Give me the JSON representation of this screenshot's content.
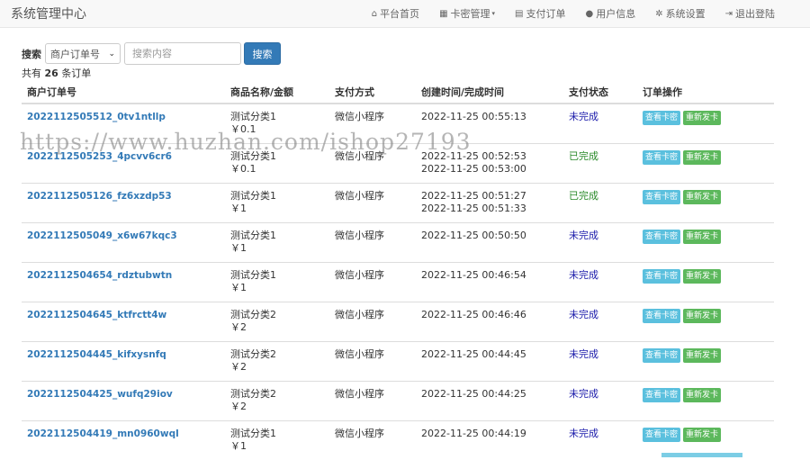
{
  "app": {
    "title": "系统管理中心"
  },
  "nav": [
    {
      "icon": "home-icon",
      "glyph": "⌂",
      "label": "平台首页"
    },
    {
      "icon": "grid-icon",
      "glyph": "▦",
      "label": "卡密管理",
      "dropdown": true
    },
    {
      "icon": "list-icon",
      "glyph": "▤",
      "label": "支付订单"
    },
    {
      "icon": "user-icon",
      "glyph": "●",
      "label": "用户信息"
    },
    {
      "icon": "gear-icon",
      "glyph": "✲",
      "label": "系统设置"
    },
    {
      "icon": "logout-icon",
      "glyph": "⇥",
      "label": "退出登陆"
    }
  ],
  "search": {
    "label": "搜索",
    "select_value": "商户订单号",
    "placeholder": "搜索内容",
    "button": "搜索"
  },
  "summary": {
    "prefix": "共有",
    "count": "26",
    "suffix": "条订单"
  },
  "table": {
    "headers": [
      "商户订单号",
      "商品名称/金额",
      "支付方式",
      "创建时间/完成时间",
      "支付状态",
      "订单操作"
    ],
    "rows": [
      {
        "id": "2022112505512_0tv1ntllp",
        "name": "测试分类1",
        "amount": "￥0.1",
        "pay": "微信小程序",
        "created": "2022-11-25 00:55:13",
        "finished": "",
        "status": "未完成",
        "done": false
      },
      {
        "id": "2022112505253_4pcvv6cr6",
        "name": "测试分类1",
        "amount": "￥0.1",
        "pay": "微信小程序",
        "created": "2022-11-25 00:52:53",
        "finished": "2022-11-25 00:53:00",
        "status": "已完成",
        "done": true
      },
      {
        "id": "2022112505126_fz6xzdp53",
        "name": "测试分类1",
        "amount": "￥1",
        "pay": "微信小程序",
        "created": "2022-11-25 00:51:27",
        "finished": "2022-11-25 00:51:33",
        "status": "已完成",
        "done": true
      },
      {
        "id": "2022112505049_x6w67kqc3",
        "name": "测试分类1",
        "amount": "￥1",
        "pay": "微信小程序",
        "created": "2022-11-25 00:50:50",
        "finished": "",
        "status": "未完成",
        "done": false
      },
      {
        "id": "2022112504654_rdztubwtn",
        "name": "测试分类1",
        "amount": "￥1",
        "pay": "微信小程序",
        "created": "2022-11-25 00:46:54",
        "finished": "",
        "status": "未完成",
        "done": false
      },
      {
        "id": "2022112504645_ktfrctt4w",
        "name": "测试分类2",
        "amount": "￥2",
        "pay": "微信小程序",
        "created": "2022-11-25 00:46:46",
        "finished": "",
        "status": "未完成",
        "done": false
      },
      {
        "id": "2022112504445_kifxysnfq",
        "name": "测试分类2",
        "amount": "￥2",
        "pay": "微信小程序",
        "created": "2022-11-25 00:44:45",
        "finished": "",
        "status": "未完成",
        "done": false
      },
      {
        "id": "2022112504425_wufq29iov",
        "name": "测试分类2",
        "amount": "￥2",
        "pay": "微信小程序",
        "created": "2022-11-25 00:44:25",
        "finished": "",
        "status": "未完成",
        "done": false
      },
      {
        "id": "2022112504419_mn0960wql",
        "name": "测试分类1",
        "amount": "￥1",
        "pay": "微信小程序",
        "created": "2022-11-25 00:44:19",
        "finished": "",
        "status": "未完成",
        "done": false
      }
    ],
    "actions": {
      "view": "查看卡密",
      "resend": "重新发卡"
    }
  },
  "watermark": "https://www.huzhan.com/ishop27193",
  "colors": {
    "link": "#337ab7",
    "pending": "#1a1aaa",
    "done": "#2a8a2a",
    "info": "#5bc0de",
    "success": "#5cb85c"
  }
}
